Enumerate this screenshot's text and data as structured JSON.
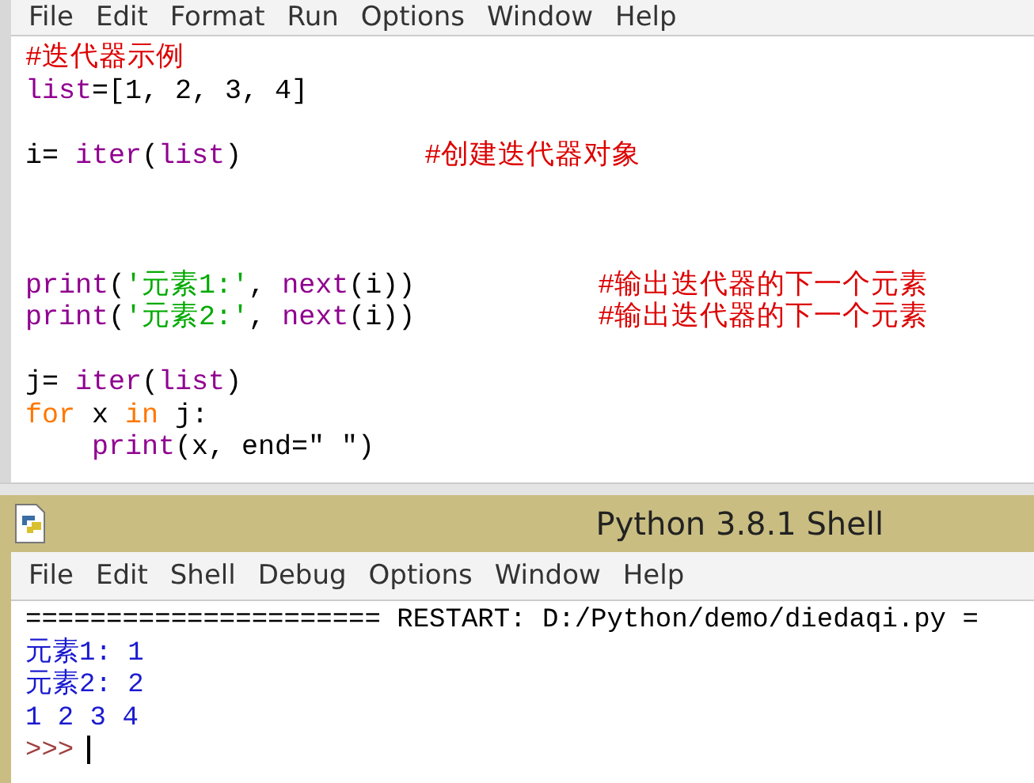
{
  "editor": {
    "menu": [
      "File",
      "Edit",
      "Format",
      "Run",
      "Options",
      "Window",
      "Help"
    ],
    "lines": [
      {
        "kind": "code",
        "tokens": [
          {
            "kind": "comment",
            "text": "#迭代器示例"
          }
        ]
      },
      {
        "kind": "code",
        "tokens": [
          {
            "kind": "builtin",
            "text": "list"
          },
          {
            "kind": "plain",
            "text": "=[1, 2, 3, 4]"
          }
        ]
      },
      {
        "kind": "blank"
      },
      {
        "kind": "code",
        "tokens": [
          {
            "kind": "plain",
            "text": "i= "
          },
          {
            "kind": "builtin",
            "text": "iter"
          },
          {
            "kind": "plain",
            "text": "("
          },
          {
            "kind": "builtin",
            "text": "list"
          },
          {
            "kind": "plain",
            "text": ")           "
          },
          {
            "kind": "comment",
            "text": "#创建迭代器对象"
          }
        ]
      },
      {
        "kind": "blank"
      },
      {
        "kind": "blank"
      },
      {
        "kind": "blank"
      },
      {
        "kind": "code",
        "tokens": [
          {
            "kind": "builtin",
            "text": "print"
          },
          {
            "kind": "plain",
            "text": "("
          },
          {
            "kind": "string",
            "text": "'元素1:'"
          },
          {
            "kind": "plain",
            "text": ", "
          },
          {
            "kind": "builtin",
            "text": "next"
          },
          {
            "kind": "plain",
            "text": "(i))           "
          },
          {
            "kind": "comment",
            "text": "#输出迭代器的下一个元素"
          }
        ]
      },
      {
        "kind": "code",
        "tokens": [
          {
            "kind": "builtin",
            "text": "print"
          },
          {
            "kind": "plain",
            "text": "("
          },
          {
            "kind": "string",
            "text": "'元素2:'"
          },
          {
            "kind": "plain",
            "text": ", "
          },
          {
            "kind": "builtin",
            "text": "next"
          },
          {
            "kind": "plain",
            "text": "(i))           "
          },
          {
            "kind": "comment",
            "text": "#输出迭代器的下一个元素"
          }
        ]
      },
      {
        "kind": "blank"
      },
      {
        "kind": "code",
        "tokens": [
          {
            "kind": "plain",
            "text": "j= "
          },
          {
            "kind": "builtin",
            "text": "iter"
          },
          {
            "kind": "plain",
            "text": "("
          },
          {
            "kind": "builtin",
            "text": "list"
          },
          {
            "kind": "plain",
            "text": ")"
          }
        ]
      },
      {
        "kind": "code",
        "tokens": [
          {
            "kind": "keyword",
            "text": "for"
          },
          {
            "kind": "plain",
            "text": " x "
          },
          {
            "kind": "keyword",
            "text": "in"
          },
          {
            "kind": "plain",
            "text": " j:"
          }
        ]
      },
      {
        "kind": "code",
        "indent": true,
        "tokens": [
          {
            "kind": "builtin",
            "text": "print"
          },
          {
            "kind": "plain",
            "text": "(x, end=\" \")"
          }
        ]
      }
    ]
  },
  "shell": {
    "title": "Python 3.8.1 Shell",
    "menu": [
      "File",
      "Edit",
      "Shell",
      "Debug",
      "Options",
      "Window",
      "Help"
    ],
    "lines": [
      {
        "kind": "restart",
        "text": "====================== RESTART: D:/Python/demo/diedaqi.py ="
      },
      {
        "kind": "output",
        "text": "元素1: 1"
      },
      {
        "kind": "output",
        "text": "元素2: 2"
      },
      {
        "kind": "output",
        "text": "1 2 3 4"
      },
      {
        "kind": "prompt",
        "text": ">>>"
      }
    ]
  }
}
